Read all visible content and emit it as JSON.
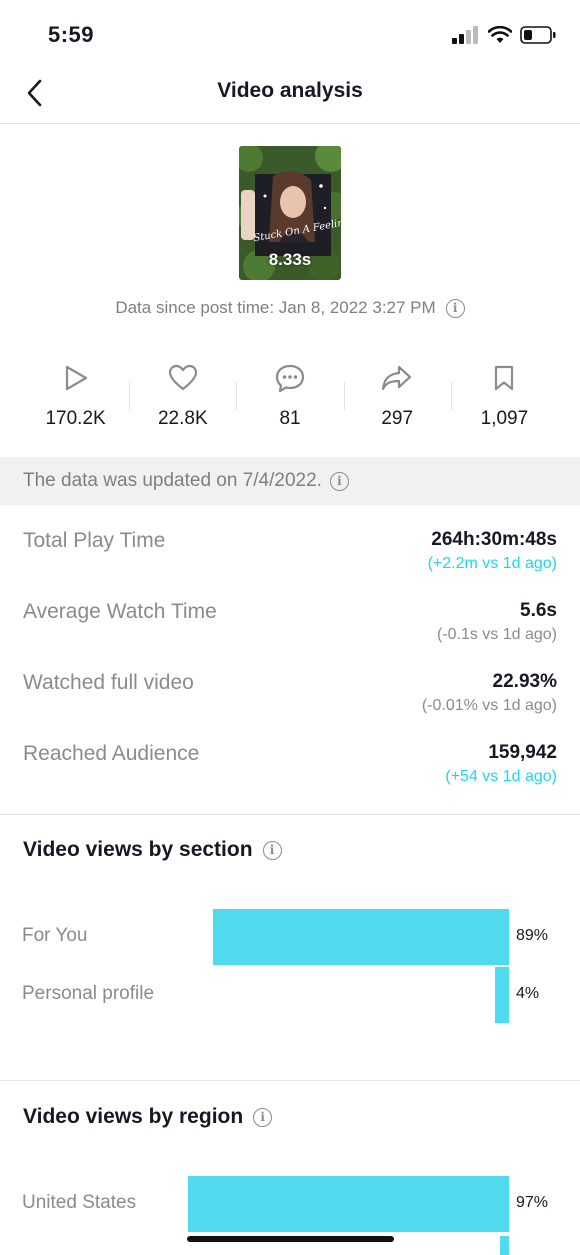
{
  "status_bar": {
    "time": "5:59"
  },
  "nav": {
    "title": "Video analysis"
  },
  "video": {
    "duration": "8.33s",
    "thumb_caption": "Stuck On A Feeling"
  },
  "post_time": "Data since post time: Jan 8, 2022 3:27 PM",
  "stats": [
    {
      "icon": "play-icon",
      "value": "170.2K"
    },
    {
      "icon": "heart-icon",
      "value": "22.8K"
    },
    {
      "icon": "comment-icon",
      "value": "81"
    },
    {
      "icon": "share-icon",
      "value": "297"
    },
    {
      "icon": "bookmark-icon",
      "value": "1,097"
    }
  ],
  "update_notice": "The data was updated on 7/4/2022.",
  "metrics": [
    {
      "label": "Total Play Time",
      "value": "264h:30m:48s",
      "delta": "(+2.2m vs 1d ago)",
      "delta_positive": true
    },
    {
      "label": "Average Watch Time",
      "value": "5.6s",
      "delta": "(-0.1s vs 1d ago)",
      "delta_positive": false
    },
    {
      "label": "Watched full video",
      "value": "22.93%",
      "delta": "(-0.01% vs 1d ago)",
      "delta_positive": false
    },
    {
      "label": "Reached Audience",
      "value": "159,942",
      "delta": "(+54 vs 1d ago)",
      "delta_positive": true
    }
  ],
  "views_by_section": {
    "title": "Video views by section",
    "rows": [
      {
        "label": "For You",
        "percent_label": "89%",
        "value": 89
      },
      {
        "label": "Personal profile",
        "percent_label": "4%",
        "value": 4
      }
    ]
  },
  "views_by_region": {
    "title": "Video views by region",
    "rows": [
      {
        "label": "United States",
        "percent_label": "97%",
        "value": 97
      }
    ]
  },
  "colors": {
    "accent": "#20d5ec",
    "bar": "#4fdbed",
    "muted": "#8a8b91",
    "banner_bg": "#f1f1f2"
  }
}
